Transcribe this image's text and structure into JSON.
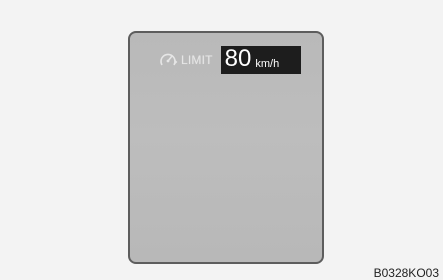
{
  "display": {
    "limit_label": "LIMIT",
    "speed_value": "80",
    "speed_unit": "km/h",
    "icon": "speed-limiter-icon"
  },
  "reference_code": "B0328KO03",
  "colors": {
    "page_background": "#f3f3f3",
    "display_background": "#bbbbbb",
    "speed_box_background": "#1d1d1d",
    "speed_text": "#ffffff",
    "label_text": "#e6e6e6"
  }
}
